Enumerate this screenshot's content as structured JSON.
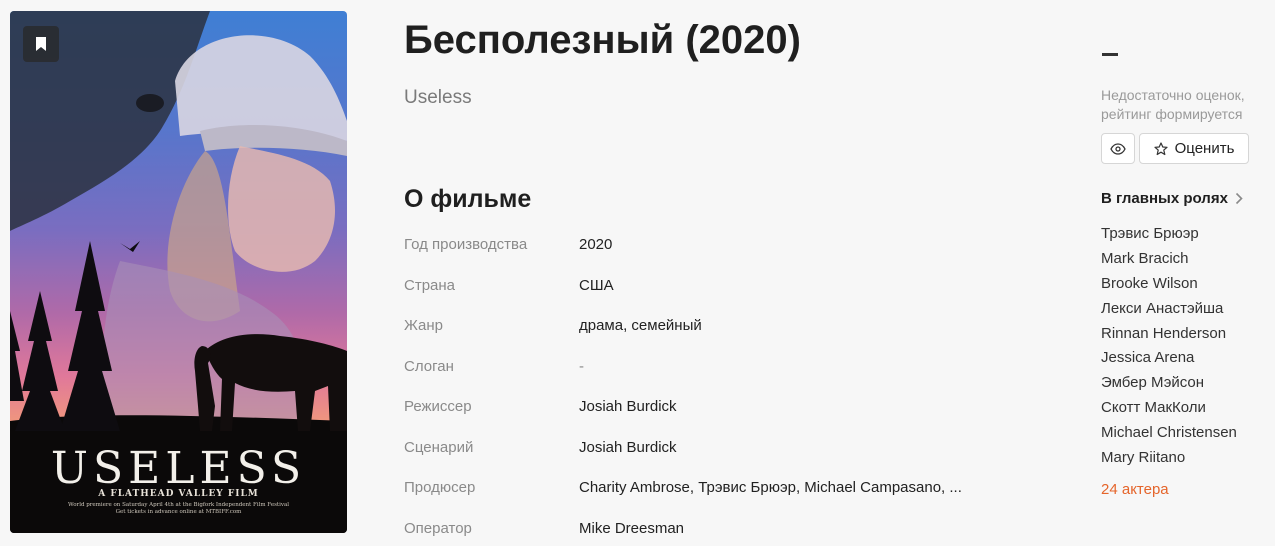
{
  "film": {
    "title": "Бесполезный (2020)",
    "original_title": "Useless"
  },
  "poster": {
    "title_text": "USELESS",
    "subtitle_text": "A FLATHEAD VALLEY FILM",
    "fine_print": "World premiere on Saturday April 4th at the Bigfork Independent Film Festival\nGet tickets in advance online at MTBIFF.com",
    "icons": {
      "bookmark": "bookmark-icon"
    }
  },
  "about": {
    "section_title": "О фильме",
    "rows": [
      {
        "label": "Год производства",
        "value": "2020"
      },
      {
        "label": "Страна",
        "value": "США"
      },
      {
        "label": "Жанр",
        "value": "драма, семейный"
      },
      {
        "label": "Слоган",
        "value": "-"
      },
      {
        "label": "Режиссер",
        "value": "Josiah Burdick"
      },
      {
        "label": "Сценарий",
        "value": "Josiah Burdick"
      },
      {
        "label": "Продюсер",
        "value": "Charity Ambrose, Трэвис Брюэр, Michael Campasano, ..."
      },
      {
        "label": "Оператор",
        "value": "Mike Dreesman"
      }
    ]
  },
  "rating": {
    "value": "–",
    "note": "Недостаточно оценок, рейтинг формируется",
    "watch_icon": "eye-icon",
    "rate_label": "Оценить",
    "rate_icon": "star-icon"
  },
  "cast": {
    "title": "В главных ролях",
    "chevron_icon": "chevron-right-icon",
    "actors": [
      "Трэвис Брюэр",
      "Mark Bracich",
      "Brooke Wilson",
      "Лекси Анастэйша",
      "Rinnan Henderson",
      "Jessica Arena",
      "Эмбер Мэйсон",
      "Скотт МакКоли",
      "Michael Christensen",
      "Mary Riitano"
    ],
    "more_label": "24 актера"
  },
  "colors": {
    "accent": "#e5652b",
    "muted_text": "#8a8a8a",
    "background": "#f7f7f7"
  }
}
